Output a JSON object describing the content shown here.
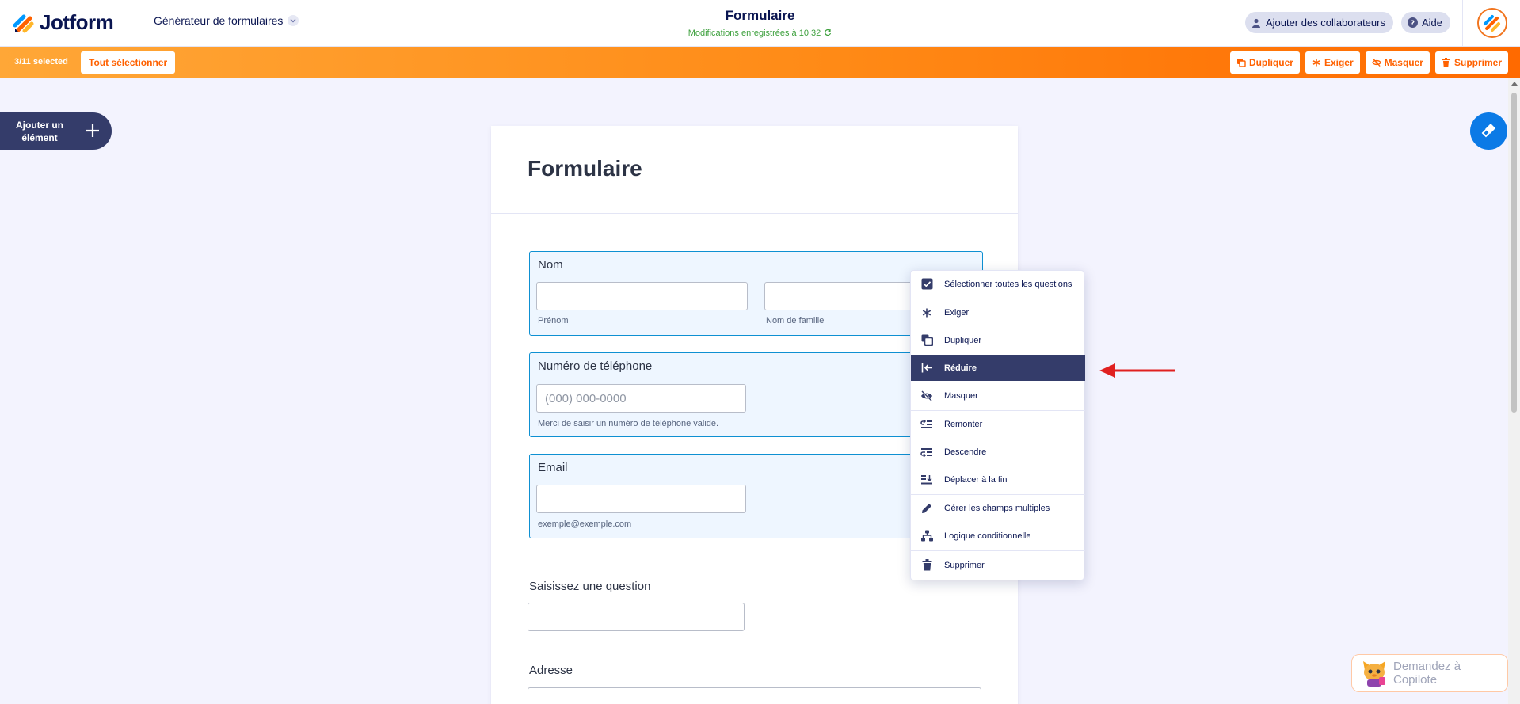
{
  "header": {
    "brand": "Jotform",
    "builder_menu": "Générateur de formulaires",
    "form_title": "Formulaire",
    "saved_status": "Modifications enregistrées à 10:32",
    "collaborators_label": "Ajouter des collaborateurs",
    "help_label": "Aide"
  },
  "selection_bar": {
    "count": "3/11 selected",
    "select_all": "Tout sélectionner",
    "actions": {
      "duplicate": "Dupliquer",
      "require": "Exiger",
      "hide": "Masquer",
      "delete": "Supprimer"
    }
  },
  "left_panel": {
    "add_element": "Ajouter un élément"
  },
  "form": {
    "title": "Formulaire",
    "name_field": {
      "label": "Nom",
      "first_sublabel": "Prénom",
      "last_sublabel": "Nom de famille"
    },
    "phone_field": {
      "label": "Numéro de téléphone",
      "placeholder": "(000) 000-0000",
      "sublabel": "Merci de saisir un numéro de téléphone valide."
    },
    "email_field": {
      "label": "Email",
      "sublabel": "exemple@exemple.com"
    },
    "question_field": {
      "label": "Saisissez une question"
    },
    "address_field": {
      "label": "Adresse"
    }
  },
  "context_menu": {
    "items": [
      {
        "label": "Sélectionner toutes les questions",
        "icon": "checkbox-checked-icon"
      },
      {
        "label": "Exiger",
        "icon": "asterisk-icon"
      },
      {
        "label": "Dupliquer",
        "icon": "duplicate-icon"
      },
      {
        "label": "Réduire",
        "icon": "shrink-icon",
        "active": true
      },
      {
        "label": "Masquer",
        "icon": "eye-off-icon"
      },
      {
        "label": "Remonter",
        "icon": "move-up-icon"
      },
      {
        "label": "Descendre",
        "icon": "move-down-icon"
      },
      {
        "label": "Déplacer à la fin",
        "icon": "move-to-end-icon"
      },
      {
        "label": "Gérer les champs multiples",
        "icon": "pencil-icon"
      },
      {
        "label": "Logique conditionnelle",
        "icon": "sitemap-icon"
      },
      {
        "label": "Supprimer",
        "icon": "trash-icon"
      }
    ]
  },
  "copilot": {
    "label": "Demandez à Copilote"
  },
  "colors": {
    "brand_orange": "#ff6100",
    "navy": "#0a1551",
    "menu_active": "#343c6a",
    "field_highlight": "#eef6ff",
    "field_border": "#0e90d2",
    "saved_green": "#3da03d",
    "annotation_red": "#e02020"
  }
}
